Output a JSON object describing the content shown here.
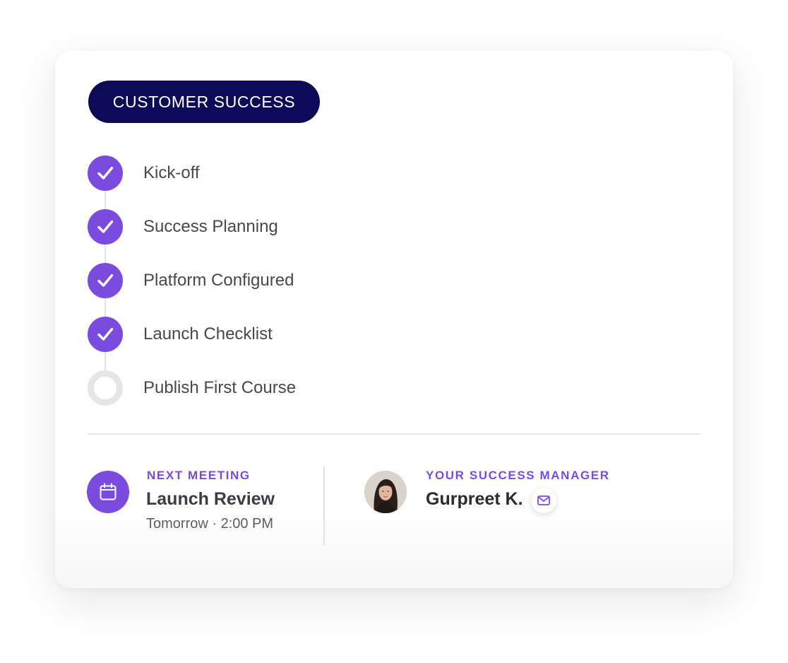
{
  "badge": {
    "label": "CUSTOMER SUCCESS"
  },
  "steps": [
    {
      "label": "Kick-off",
      "status": "complete"
    },
    {
      "label": "Success Planning",
      "status": "complete"
    },
    {
      "label": "Platform Configured",
      "status": "complete"
    },
    {
      "label": "Launch Checklist",
      "status": "complete"
    },
    {
      "label": "Publish First Course",
      "status": "pending"
    }
  ],
  "meeting": {
    "eyebrow": "NEXT MEETING",
    "title": "Launch Review",
    "when": "Tomorrow ·  2:00 PM",
    "icon": "calendar-icon"
  },
  "manager": {
    "eyebrow": "YOUR SUCCESS MANAGER",
    "name": "Gurpreet K.",
    "icon": "mail-icon"
  },
  "colors": {
    "accent": "#7b4be0",
    "badge_bg": "#0d0a57",
    "pending": "#e6e6e8"
  }
}
